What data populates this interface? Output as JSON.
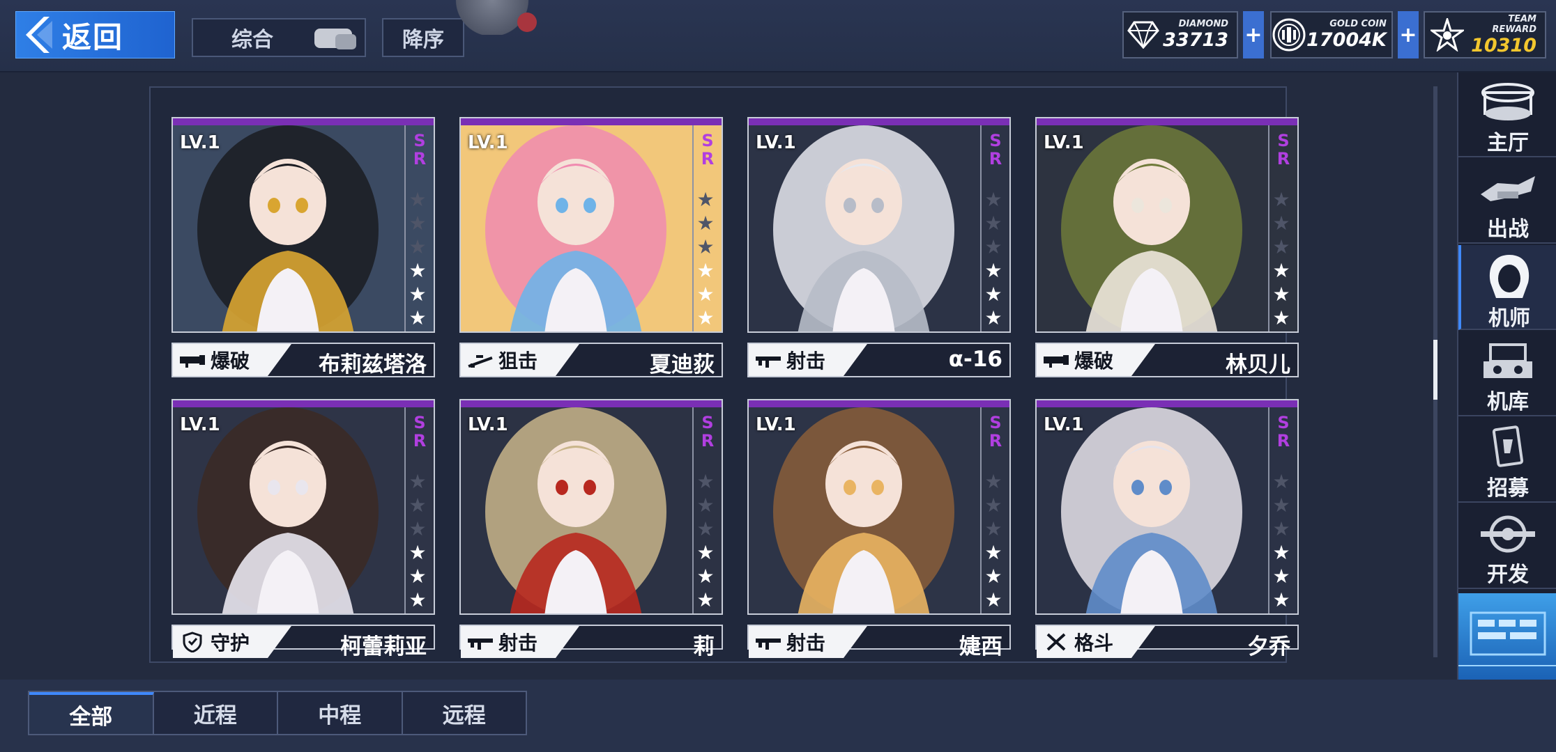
{
  "header": {
    "back_label": "返回",
    "sort_label": "综合",
    "order_label": "降序"
  },
  "currencies": [
    {
      "caption": "DIAMOND",
      "value": "33713",
      "icon": "diamond-icon"
    },
    {
      "caption": "GOLD COIN",
      "value": "17004K",
      "icon": "gold-coin-icon"
    },
    {
      "caption": "TEAM REWARD",
      "value": "10310",
      "icon": "team-reward-icon"
    }
  ],
  "plus_label": "+",
  "cards": [
    {
      "level": "LV.1",
      "rarity": "SR",
      "stars_on": 3,
      "stars_off": 3,
      "role": "爆破",
      "role_icon": "rocket-launcher-icon",
      "name": "布莉兹塔洛",
      "art_colors": [
        "#3b4a62",
        "#1b1c22",
        "#d9a531"
      ]
    },
    {
      "level": "LV.1",
      "rarity": "SR",
      "stars_on": 3,
      "stars_off": 3,
      "role": "狙击",
      "role_icon": "sniper-rifle-icon",
      "name": "夏迪荻",
      "art_colors": [
        "#f2c77a",
        "#f08bb0",
        "#6fb3e8"
      ]
    },
    {
      "level": "LV.1",
      "rarity": "SR",
      "stars_on": 3,
      "stars_off": 3,
      "role": "射击",
      "role_icon": "assault-rifle-icon",
      "name": "α-16",
      "art_colors": [
        "#2c3346",
        "#e6e8ee",
        "#b7bcc8"
      ]
    },
    {
      "level": "LV.1",
      "rarity": "SR",
      "stars_on": 3,
      "stars_off": 3,
      "role": "爆破",
      "role_icon": "rocket-launcher-icon",
      "name": "林贝儿",
      "art_colors": [
        "#2d3340",
        "#6f7a3a",
        "#ece6dc"
      ]
    },
    {
      "level": "LV.1",
      "rarity": "SR",
      "stars_on": 3,
      "stars_off": 3,
      "role": "守护",
      "role_icon": "shield-icon",
      "name": "柯蕾莉亚",
      "art_colors": [
        "#2e3447",
        "#3b2a25",
        "#e9e6ee"
      ]
    },
    {
      "level": "LV.1",
      "rarity": "SR",
      "stars_on": 3,
      "stars_off": 3,
      "role": "射击",
      "role_icon": "assault-rifle-icon",
      "name": "莉",
      "art_colors": [
        "#2c3244",
        "#c9b58a",
        "#b8281f"
      ]
    },
    {
      "level": "LV.1",
      "rarity": "SR",
      "stars_on": 3,
      "stars_off": 3,
      "role": "射击",
      "role_icon": "assault-rifle-icon",
      "name": "婕西",
      "art_colors": [
        "#2d3447",
        "#8a5e3a",
        "#e9b462"
      ]
    },
    {
      "level": "LV.1",
      "rarity": "SR",
      "stars_on": 3,
      "stars_off": 3,
      "role": "格斗",
      "role_icon": "crossed-swords-icon",
      "name": "夕乔",
      "art_colors": [
        "#2b3246",
        "#e6e3ea",
        "#5f8cc9"
      ]
    }
  ],
  "nav": [
    {
      "label": "主厅",
      "icon": "main-hall-icon"
    },
    {
      "label": "出战",
      "icon": "sortie-icon"
    },
    {
      "label": "机师",
      "icon": "pilot-icon",
      "active": true
    },
    {
      "label": "机库",
      "icon": "hangar-icon"
    },
    {
      "label": "招募",
      "icon": "recruit-icon"
    },
    {
      "label": "开发",
      "icon": "develop-icon"
    }
  ],
  "tabs": [
    {
      "label": "全部",
      "active": true
    },
    {
      "label": "近程"
    },
    {
      "label": "中程"
    },
    {
      "label": "远程"
    }
  ],
  "colors": {
    "accent": "#3f89ff",
    "rarity": "#b13fe0",
    "gold": "#f3c72e"
  }
}
